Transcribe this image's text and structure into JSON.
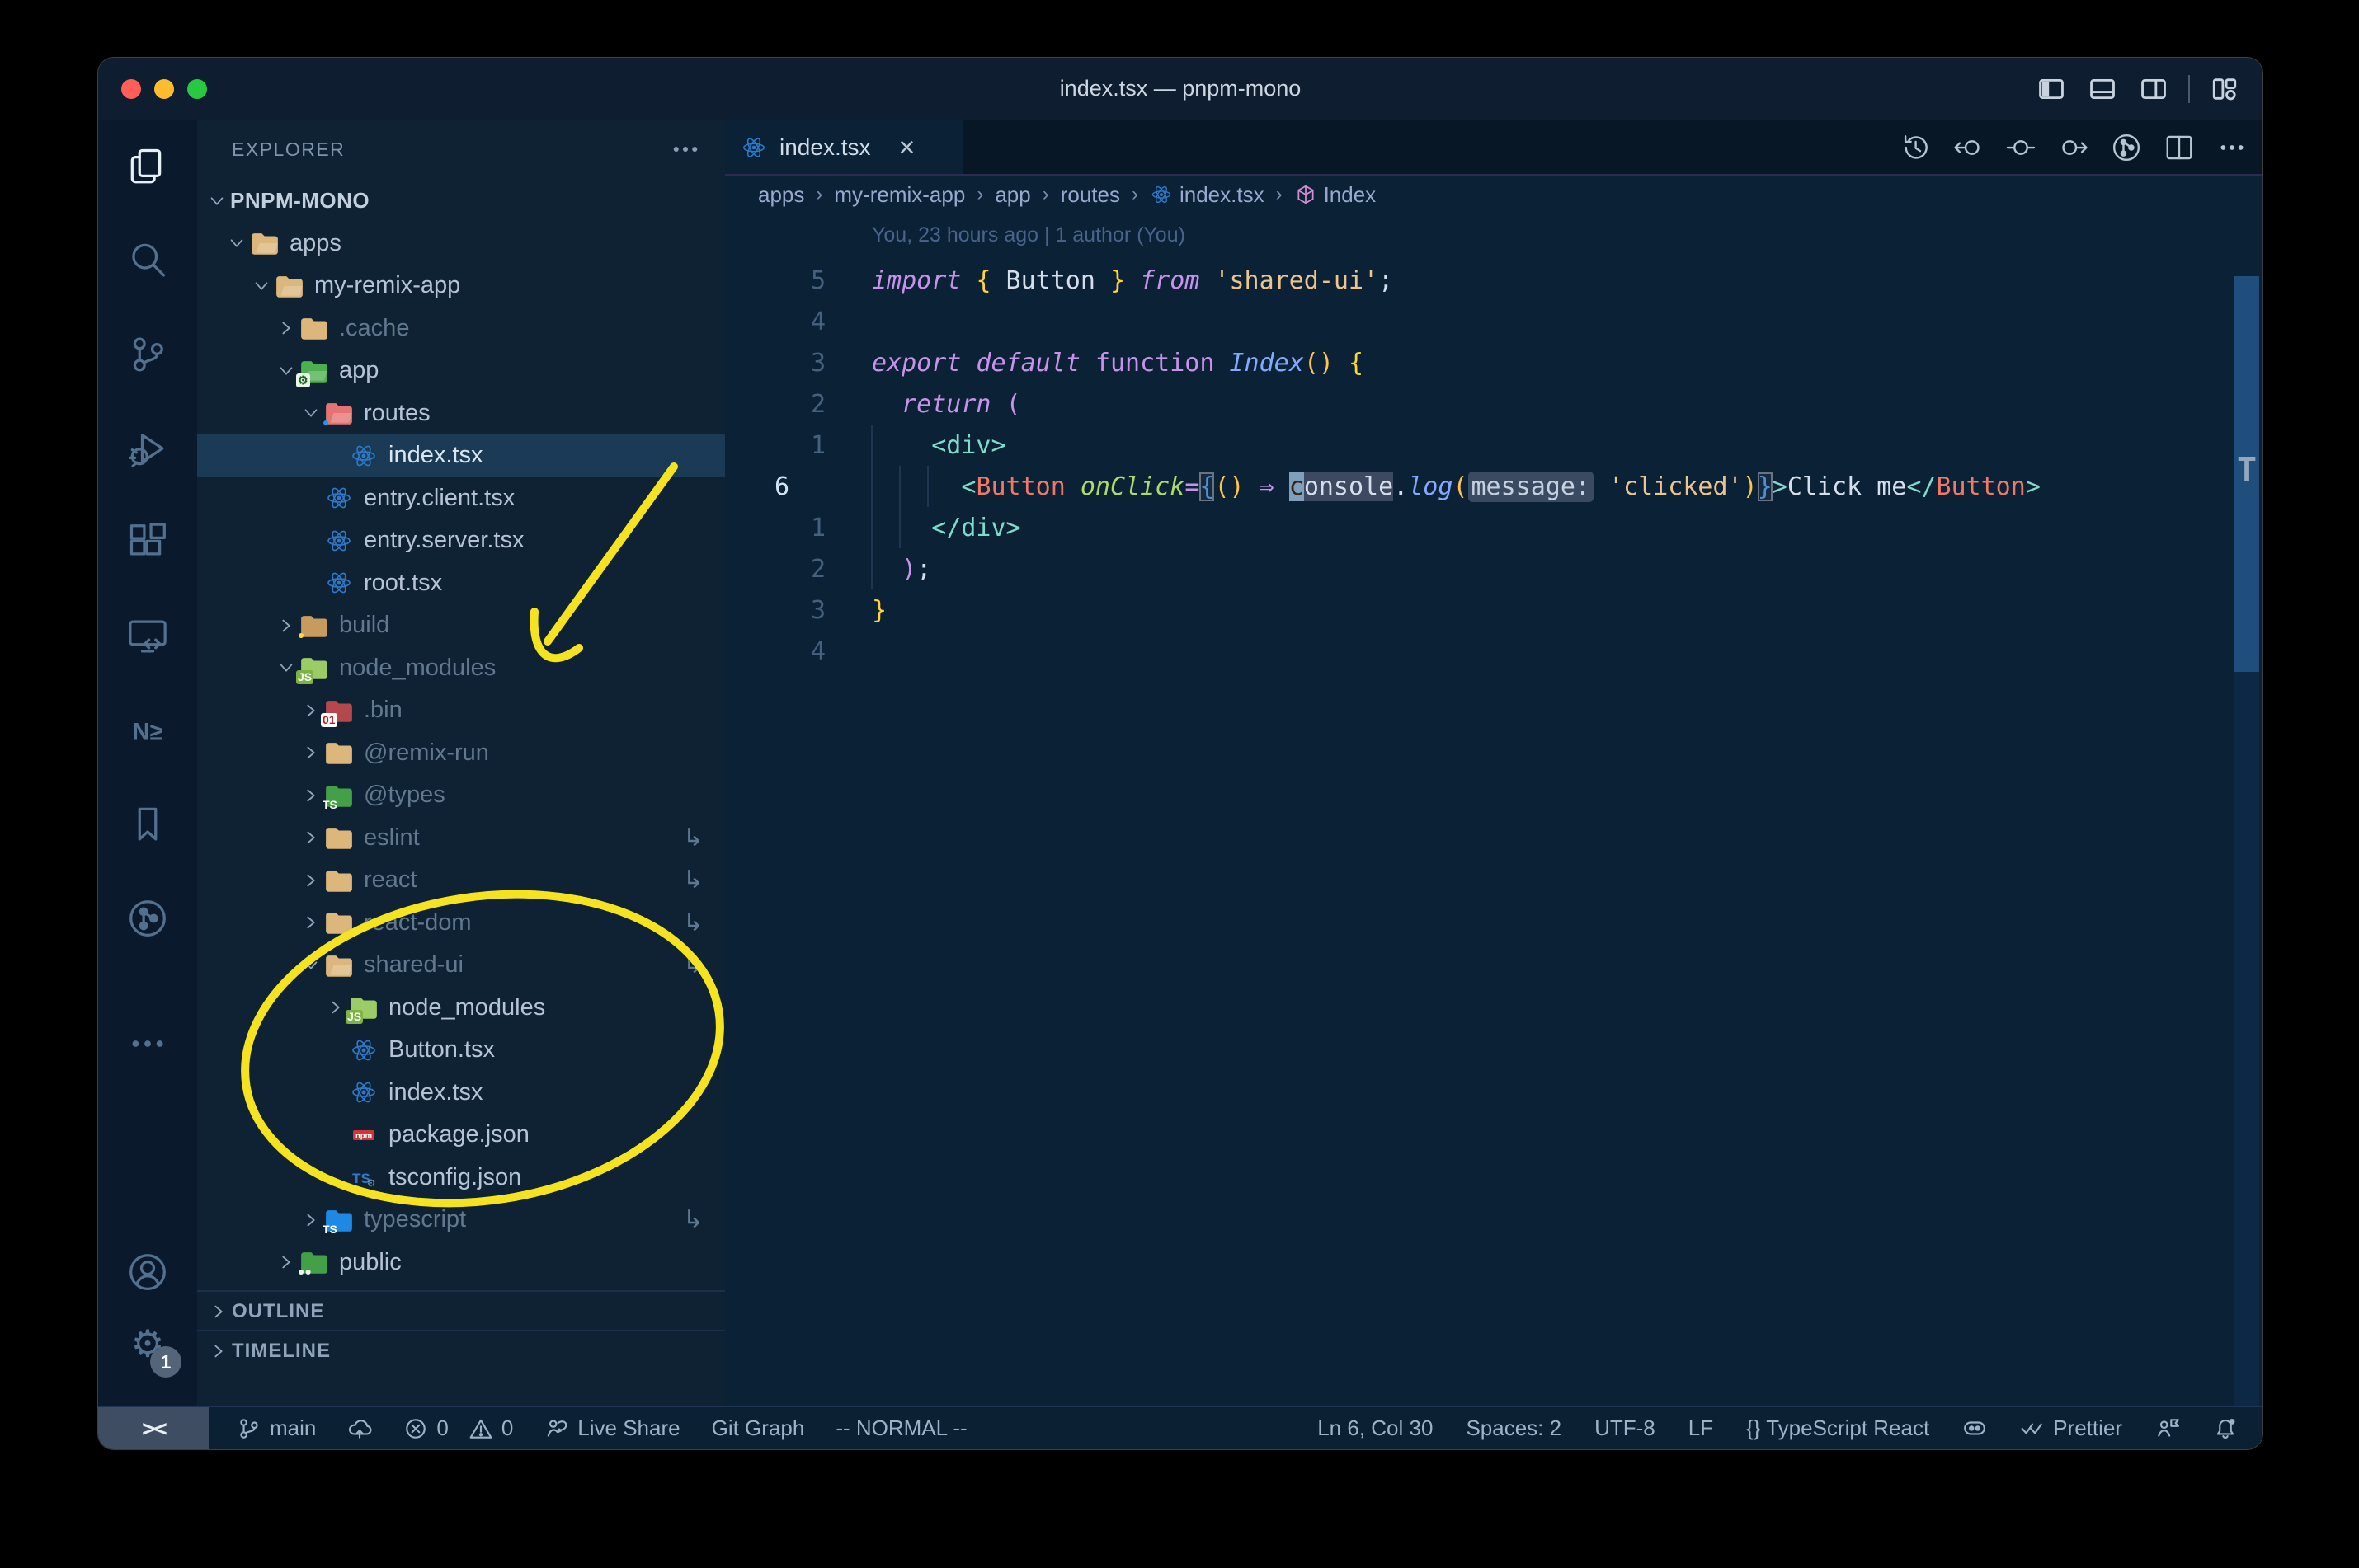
{
  "window": {
    "title": "index.tsx — pnpm-mono"
  },
  "palette": {
    "annotation": "#f5e322",
    "purple": "#c792ea",
    "funcblue": "#82aaff",
    "strtan": "#ecc48d",
    "teal": "#7fdbca",
    "salmon": "#f07866",
    "lime": "#addb67",
    "reactBlue": "#2d79c7",
    "npmRed": "#cb3837",
    "tsBlue": "#3178c6",
    "folderTan": "#dcb67a",
    "trafficRed": "#ff5f57",
    "trafficYellow": "#febc2e",
    "trafficGreen": "#28c840"
  },
  "titlebar": {
    "icons": [
      "layout-sidebar-left-icon",
      "layout-panel-icon",
      "layout-sidebar-right-icon",
      "|",
      "layout-customize-icon"
    ]
  },
  "activity_bar": {
    "top": [
      {
        "icon": "files-icon",
        "active": true
      },
      {
        "icon": "search-icon"
      },
      {
        "icon": "source-control-icon"
      },
      {
        "icon": "run-debug-icon"
      },
      {
        "icon": "extensions-icon"
      },
      {
        "icon": "remote-explorer-icon"
      },
      {
        "icon": "nx-console-icon"
      },
      {
        "icon": "bookmarks-icon"
      },
      {
        "icon": "gitlens-icon"
      }
    ],
    "bottom": [
      {
        "icon": "more-icon"
      },
      {
        "icon": "account-icon"
      },
      {
        "icon": "settings-gear-icon",
        "badge": "1"
      }
    ]
  },
  "sidebar": {
    "header": "EXPLORER",
    "tree": [
      {
        "label": "PNPM-MONO",
        "depth": 0,
        "kind": "root",
        "state": "open"
      },
      {
        "label": "apps",
        "depth": 1,
        "kind": "folder",
        "state": "open",
        "icon": "tan-open"
      },
      {
        "label": "my-remix-app",
        "depth": 2,
        "kind": "folder",
        "state": "open",
        "icon": "tan-open"
      },
      {
        "label": ".cache",
        "depth": 3,
        "kind": "folder",
        "state": "closed",
        "icon": "tan",
        "dim": true
      },
      {
        "label": "app",
        "depth": 3,
        "kind": "folder",
        "state": "open",
        "icon": "app"
      },
      {
        "label": "routes",
        "depth": 4,
        "kind": "folder",
        "state": "open",
        "icon": "routes"
      },
      {
        "label": "index.tsx",
        "depth": 5,
        "kind": "file",
        "icon": "react",
        "selected": true
      },
      {
        "label": "entry.client.tsx",
        "depth": 4,
        "kind": "file",
        "icon": "react"
      },
      {
        "label": "entry.server.tsx",
        "depth": 4,
        "kind": "file",
        "icon": "react"
      },
      {
        "label": "root.tsx",
        "depth": 4,
        "kind": "file",
        "icon": "react"
      },
      {
        "label": "build",
        "depth": 3,
        "kind": "folder",
        "state": "closed",
        "icon": "build",
        "dim": true
      },
      {
        "label": "node_modules",
        "depth": 3,
        "kind": "folder",
        "state": "open",
        "icon": "node",
        "dim": true
      },
      {
        "label": ".bin",
        "depth": 4,
        "kind": "folder",
        "state": "closed",
        "icon": "binary",
        "dim": true
      },
      {
        "label": "@remix-run",
        "depth": 4,
        "kind": "folder",
        "state": "closed",
        "icon": "tan",
        "dim": true
      },
      {
        "label": "@types",
        "depth": 4,
        "kind": "folder",
        "state": "closed",
        "icon": "types",
        "dim": true
      },
      {
        "label": "eslint",
        "depth": 4,
        "kind": "folder",
        "state": "closed",
        "icon": "tan",
        "dim": true,
        "symlink": true
      },
      {
        "label": "react",
        "depth": 4,
        "kind": "folder",
        "state": "closed",
        "icon": "tan",
        "dim": true,
        "symlink": true
      },
      {
        "label": "react-dom",
        "depth": 4,
        "kind": "folder",
        "state": "closed",
        "icon": "tan",
        "dim": true,
        "symlink": true
      },
      {
        "label": "shared-ui",
        "depth": 4,
        "kind": "folder",
        "state": "open",
        "icon": "tan-open",
        "dim": true,
        "symlink": true
      },
      {
        "label": "node_modules",
        "depth": 5,
        "kind": "folder",
        "state": "closed",
        "icon": "node"
      },
      {
        "label": "Button.tsx",
        "depth": 5,
        "kind": "file",
        "icon": "react"
      },
      {
        "label": "index.tsx",
        "depth": 5,
        "kind": "file",
        "icon": "react"
      },
      {
        "label": "package.json",
        "depth": 5,
        "kind": "file",
        "icon": "npm"
      },
      {
        "label": "tsconfig.json",
        "depth": 5,
        "kind": "file",
        "icon": "tsgear"
      },
      {
        "label": "typescript",
        "depth": 4,
        "kind": "folder",
        "state": "closed",
        "icon": "tsfolder",
        "dim": true,
        "symlink": true
      },
      {
        "label": "public",
        "depth": 3,
        "kind": "folder",
        "state": "closed",
        "icon": "public"
      }
    ],
    "sections": [
      {
        "label": "OUTLINE"
      },
      {
        "label": "TIMELINE"
      }
    ]
  },
  "editor": {
    "tab": {
      "label": "index.tsx",
      "icon": "react-icon",
      "close": "×"
    },
    "actions": [
      "history-icon",
      "prev-change-icon",
      "change-icon",
      "next-change-icon",
      "gitlens-graph-icon",
      "split-editor-icon",
      "more-icon"
    ],
    "breadcrumbs": [
      {
        "label": "apps"
      },
      {
        "label": "my-remix-app"
      },
      {
        "label": "app"
      },
      {
        "label": "routes"
      },
      {
        "label": "index.tsx",
        "icon": "react-icon"
      },
      {
        "label": "Index",
        "icon": "symbol-cube-icon"
      }
    ],
    "blame": "You, 23 hours ago | 1 author (You)",
    "lines": [
      {
        "num": "5",
        "tokens": [
          [
            "kw",
            "import "
          ],
          [
            "brace",
            "{"
          ],
          [
            "txt",
            " Button "
          ],
          [
            "brace",
            "}"
          ],
          [
            "kw",
            " from "
          ],
          [
            "str",
            "'shared-ui'"
          ],
          [
            "txt",
            ";"
          ]
        ]
      },
      {
        "num": "4",
        "tokens": []
      },
      {
        "num": "3",
        "tokens": [
          [
            "kw",
            "export "
          ],
          [
            "kw",
            "default "
          ],
          [
            "kwf",
            "function "
          ],
          [
            "fni",
            "Index"
          ],
          [
            "paren",
            "()"
          ],
          [
            "txt",
            " "
          ],
          [
            "brace",
            "{"
          ]
        ]
      },
      {
        "num": "2",
        "tokens": [
          [
            "txt",
            "  "
          ],
          [
            "kw",
            "return "
          ],
          [
            "pink",
            "("
          ]
        ]
      },
      {
        "num": "1",
        "tokens": [
          [
            "txt",
            "    "
          ],
          [
            "tag",
            "<div>"
          ]
        ]
      },
      {
        "num": "6",
        "current": true,
        "tokens": [
          [
            "txt",
            "      "
          ],
          [
            "tag",
            "<"
          ],
          [
            "comp",
            "Button"
          ],
          [
            "txt",
            " "
          ],
          [
            "attr",
            "onClick"
          ],
          [
            "pink",
            "="
          ],
          [
            "bm",
            "{"
          ],
          [
            "paren",
            "()"
          ],
          [
            "txt",
            " "
          ],
          [
            "arrow",
            "⇒"
          ],
          [
            "txt",
            " "
          ],
          [
            "cursor",
            "c"
          ],
          [
            "hl",
            "onsole"
          ],
          [
            "txt",
            "."
          ],
          [
            "fn",
            "log"
          ],
          [
            "paren",
            "("
          ],
          [
            "inlay",
            "message:"
          ],
          [
            "txt",
            " "
          ],
          [
            "str",
            "'clicked'"
          ],
          [
            "paren",
            ")"
          ],
          [
            "bm",
            "}"
          ],
          [
            "tag",
            ">"
          ],
          [
            "txt",
            "Click me"
          ],
          [
            "tag",
            "</"
          ],
          [
            "comp",
            "Button"
          ],
          [
            "tag",
            ">"
          ]
        ]
      },
      {
        "num": "1",
        "tokens": [
          [
            "txt",
            "    "
          ],
          [
            "tag",
            "</div>"
          ]
        ]
      },
      {
        "num": "2",
        "tokens": [
          [
            "txt",
            "  "
          ],
          [
            "pink",
            ")"
          ],
          [
            "txt",
            ";"
          ]
        ]
      },
      {
        "num": "3",
        "tokens": [
          [
            "brace",
            "}"
          ]
        ]
      },
      {
        "num": "4",
        "tokens": []
      }
    ]
  },
  "status_bar": {
    "remote": "><",
    "left": [
      {
        "icon": "git-branch-icon",
        "label": "main"
      },
      {
        "icon": "cloud-upload-icon"
      },
      {
        "icon": "error-icon",
        "label": "0",
        "icon2": "warning-icon",
        "label2": "0"
      },
      {
        "icon": "live-share-icon",
        "label": "Live Share"
      },
      {
        "label": "Git Graph"
      },
      {
        "label": "-- NORMAL --"
      }
    ],
    "right": [
      {
        "label": "Ln 6, Col 30"
      },
      {
        "label": "Spaces: 2"
      },
      {
        "label": "UTF-8"
      },
      {
        "label": "LF"
      },
      {
        "label": "{} TypeScript React"
      },
      {
        "icon": "copilot-icon"
      },
      {
        "icon": "prettier-checks-icon",
        "label": "Prettier"
      },
      {
        "icon": "feedback-icon"
      },
      {
        "icon": "bell-dot-icon"
      }
    ]
  }
}
